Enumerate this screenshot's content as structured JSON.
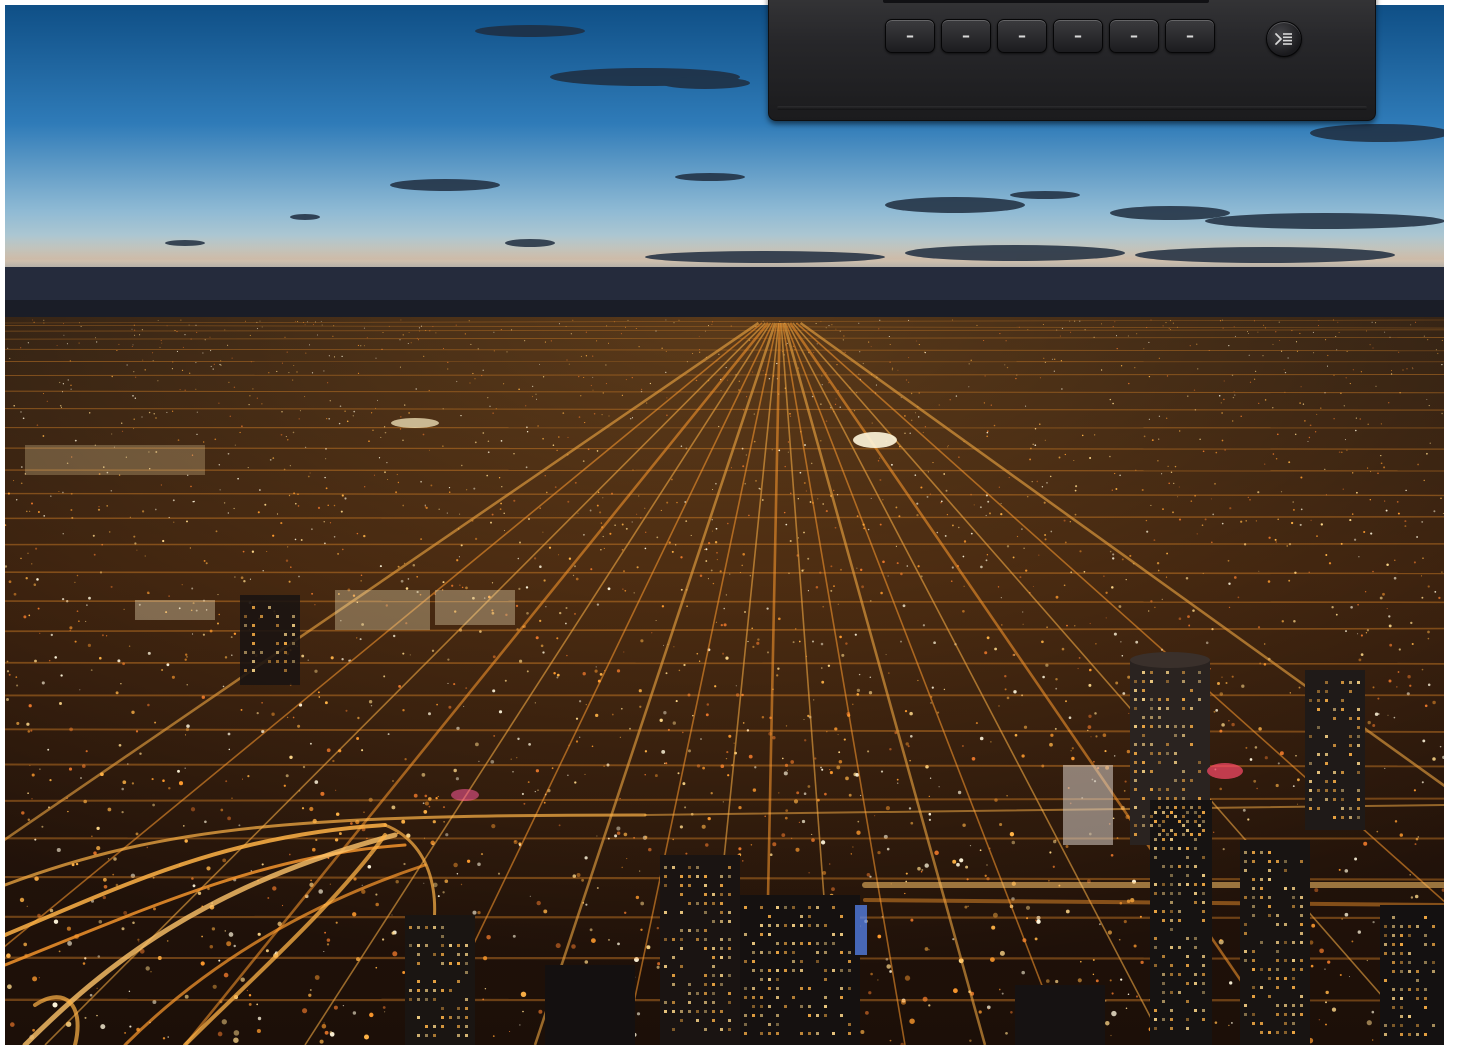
{
  "image": {
    "alt": "",
    "sky_colors": [
      "#0f4f86",
      "#2f7bb8",
      "#8fbad4",
      "#c9d3cf",
      "#3b4256",
      "#1d2333"
    ],
    "light_colors": [
      "#ffb347",
      "#ff9b2e",
      "#ffd98a",
      "#fff6dc",
      "#e8762a"
    ]
  },
  "device": {
    "softkeys": [
      "–",
      "–",
      "–",
      "–",
      "–",
      "–"
    ],
    "menu_button_icon": "play-list-icon"
  }
}
